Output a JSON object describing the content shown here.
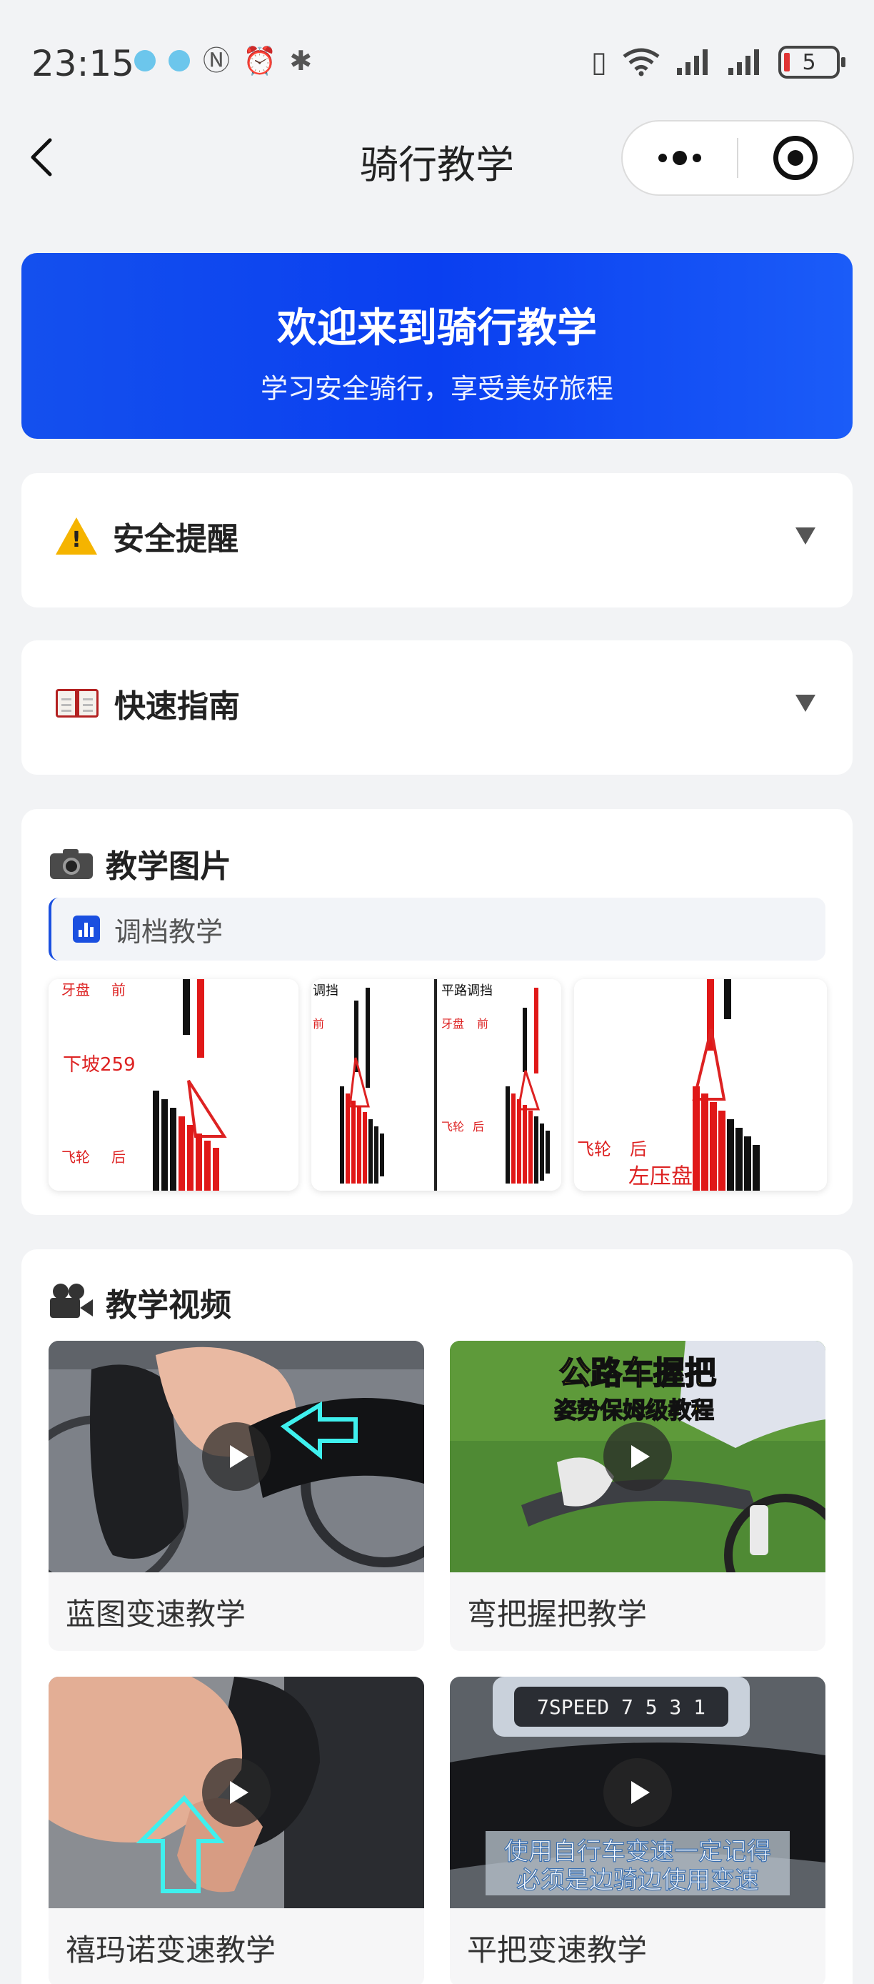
{
  "status_bar": {
    "time": "23:15",
    "battery_level": "5",
    "left_icons": [
      "notification-dot-icon",
      "notification-dot-icon",
      "nfc-icon",
      "alarm-icon",
      "bluetooth-icon"
    ],
    "right_icons": [
      "vibrate-icon",
      "wifi-icon",
      "signal-icon",
      "signal-icon",
      "battery-icon"
    ]
  },
  "nav": {
    "title": "骑行教学"
  },
  "hero": {
    "title": "欢迎来到骑行教学",
    "subtitle": "学习安全骑行，享受美好旅程",
    "gradient": [
      "#1450ee",
      "#1b5cf8"
    ]
  },
  "safety": {
    "icon": "warning-icon",
    "title": "安全提醒"
  },
  "guide": {
    "icon": "book-icon",
    "title": "快速指南"
  },
  "images_section": {
    "icon": "camera-icon",
    "title": "教学图片",
    "tab_label": "调档教学",
    "thumbnails": [
      {
        "name": "gear-chart-downhill",
        "texts": [
          "牙盘",
          "前",
          "下坡259",
          "飞轮",
          "后"
        ]
      },
      {
        "name": "gear-chart-shift",
        "texts": [
          "调挡",
          "前"
        ]
      },
      {
        "name": "gear-chart-flat",
        "texts": [
          "平路调挡",
          "牙盘",
          "前",
          "飞轮",
          "后"
        ]
      },
      {
        "name": "gear-chart-left-chainring",
        "texts": [
          "飞轮",
          "后",
          "左压盘"
        ]
      }
    ]
  },
  "videos_section": {
    "icon": "movie-camera-icon",
    "title": "教学视频",
    "videos": [
      {
        "title": "蓝图变速教学",
        "overlay": ""
      },
      {
        "title": "弯把握把教学",
        "overlay_line1": "公路车握把",
        "overlay_line2": "姿势保姆级教程"
      },
      {
        "title": "禧玛诺变速教学",
        "overlay": ""
      },
      {
        "title": "平把变速教学",
        "overlay_line1": "使用自行车变速一定记得",
        "overlay_line2": "必须是边骑边使用变速",
        "display": "7SPEED 7 5 3 1"
      }
    ]
  },
  "colors": {
    "accent": "#1a4fe0",
    "background": "#f2f3f5",
    "warning": "#f5b400",
    "chart_red": "#e01818"
  }
}
